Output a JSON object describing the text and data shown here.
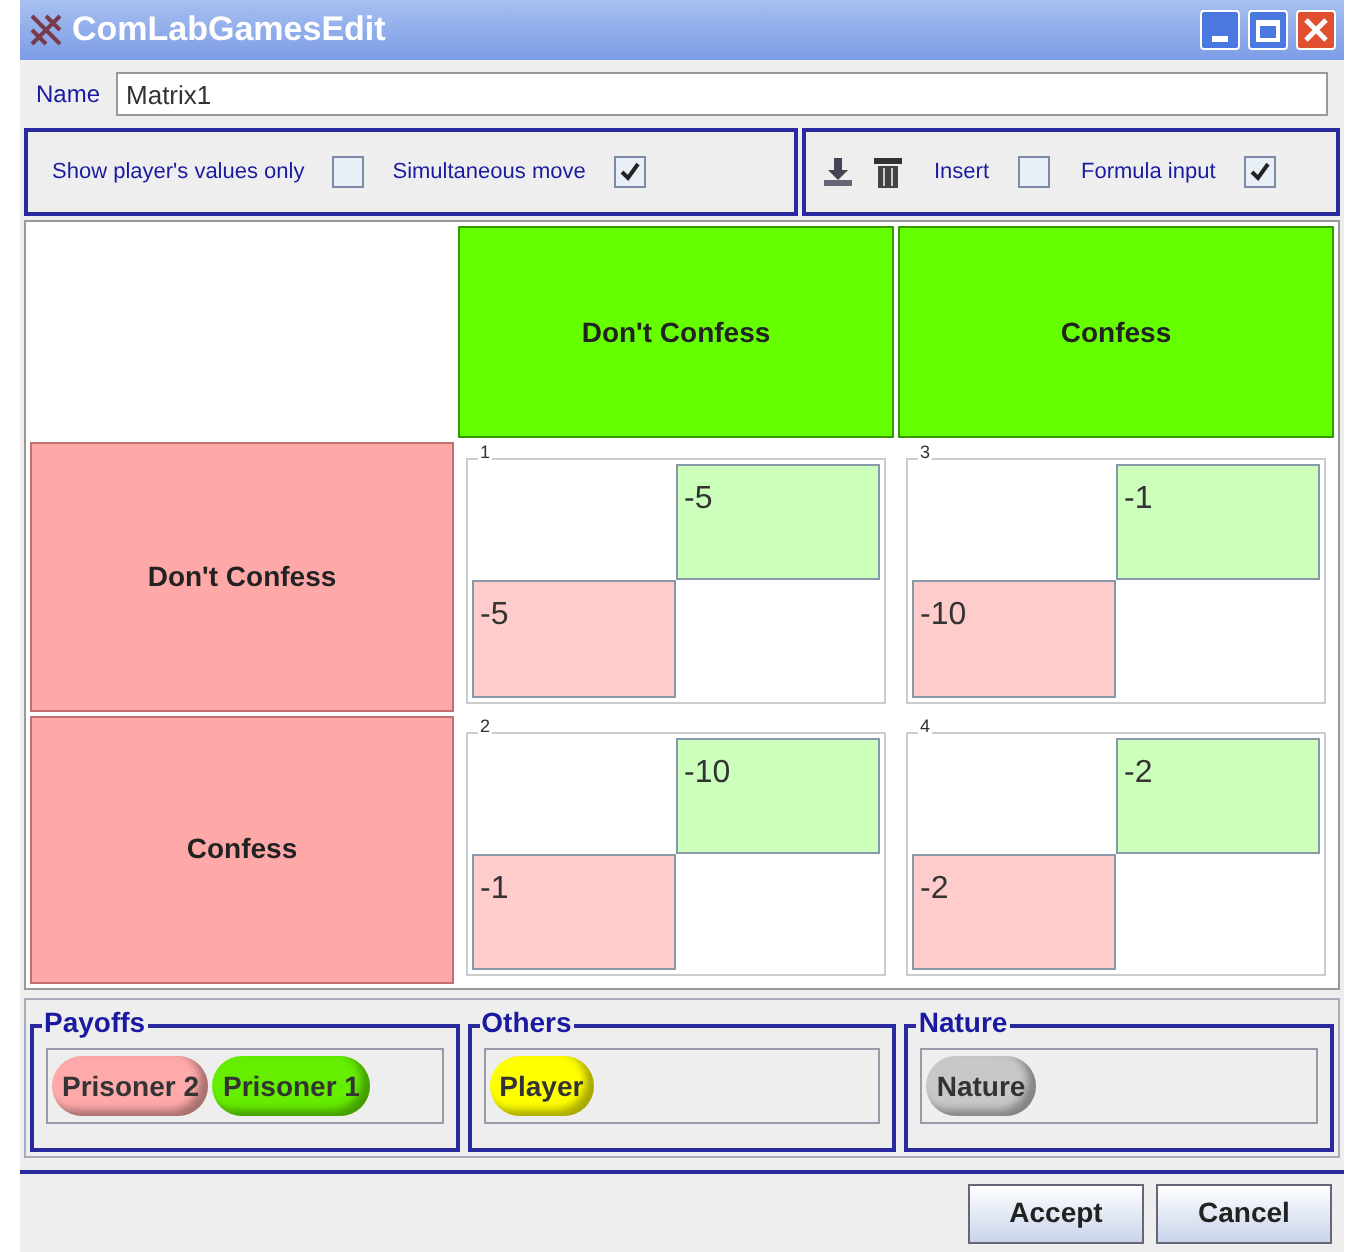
{
  "window": {
    "title": "ComLabGamesEdit"
  },
  "name_field": {
    "label": "Name",
    "value": "Matrix1"
  },
  "options": [
    {
      "label": "Show player's values only",
      "checked": false
    },
    {
      "label": "Simultaneous move",
      "checked": true
    }
  ],
  "tools": [
    {
      "kind": "download"
    },
    {
      "kind": "trash"
    },
    {
      "kind": "checkbox",
      "label": "Insert",
      "checked": false
    },
    {
      "kind": "checkbox",
      "label": "Formula input",
      "checked": true
    }
  ],
  "matrix": {
    "columns": [
      {
        "label": "Don't Confess",
        "color": "#66ff00"
      },
      {
        "label": "Confess",
        "color": "#66ff00"
      }
    ],
    "rows": [
      {
        "label": "Don't Confess",
        "color": "#ffa8a8",
        "cells": [
          {
            "number": "1",
            "column_payoff": "-5",
            "row_payoff": "-5"
          },
          {
            "number": "3",
            "column_payoff": "-1",
            "row_payoff": "-10"
          }
        ]
      },
      {
        "label": "Confess",
        "color": "#ffa8a8",
        "cells": [
          {
            "number": "2",
            "column_payoff": "-10",
            "row_payoff": "-1"
          },
          {
            "number": "4",
            "column_payoff": "-2",
            "row_payoff": "-2"
          }
        ]
      }
    ]
  },
  "panels": [
    {
      "title": "Payoffs",
      "players": [
        {
          "label": "Prisoner 2",
          "color": "#ffaaaa"
        },
        {
          "label": "Prisoner 1",
          "color": "#66ee00"
        }
      ]
    },
    {
      "title": "Others",
      "players": [
        {
          "label": "Player",
          "color": "#ffff00"
        }
      ]
    },
    {
      "title": "Nature",
      "players": [
        {
          "label": "Nature",
          "color": "#c8c8c8"
        }
      ]
    }
  ],
  "buttons": [
    "Accept",
    "Cancel"
  ]
}
